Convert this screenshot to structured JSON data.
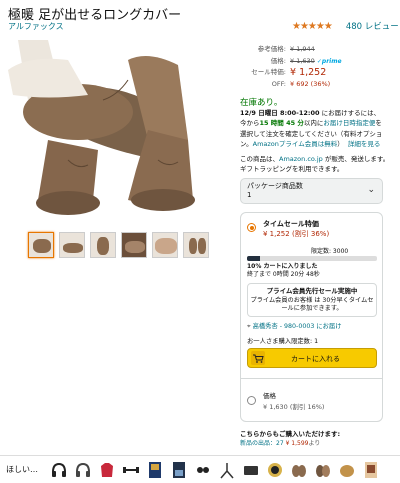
{
  "product": {
    "title": "極暖 足が出せるロングカバー",
    "brand": "アルファックス",
    "stars": "★★★★★",
    "rating_value": 4.5,
    "review_count": "480 レビュー"
  },
  "pricing": {
    "list_label": "参考価格:",
    "list_price": "¥ 1,944",
    "price_label": "価格:",
    "price": "¥ 1,630",
    "prime": "✓prime",
    "sale_label": "セール特価:",
    "sale_price": "¥ 1,252",
    "off_label": "OFF:",
    "off_value": "¥ 692 (36%)"
  },
  "availability": {
    "stock": "在庫あり。",
    "delivery_date": "12/9 日曜日 8:00-12:00",
    "delivery_text_1": " にお届けするには、今から",
    "countdown": "15 時間 45 分",
    "delivery_text_2": "以内に",
    "delivery_link_1": "お届け日時指定便",
    "delivery_text_3": "を選択して注文を確定してください（有料オプション。",
    "delivery_link_2": "Amazonプライム会員は無料",
    "delivery_text_4": "）",
    "details_link": "詳細を見る",
    "seller_text_1": "この商品は、",
    "seller_link": "Amazon.co.jp",
    "seller_text_2": " が販売、発送します。ギフトラッピングを利用できます。"
  },
  "package": {
    "label": "パッケージ商品数",
    "value": "1"
  },
  "deal": {
    "name": "タイムセール特価",
    "price": "¥ 1,252 (割引 36%)",
    "claimed_label": "限定数: 3000",
    "claimed_fraction": 0.1,
    "claimed_text": "10% カートに入りました",
    "ends_text": "終了まで 0時間 20分 48秒",
    "prime_head": "プライム会員先行セール実施中",
    "prime_body": "プライム会員のお客様 は 30分早くタイムセールに参加できます。",
    "address": "高橋秀杏 - 980-0003 にお届け",
    "limit_text": "お一人さま購入限定数: 1",
    "cart_button": "カートに入れる"
  },
  "alternative": {
    "name": "価格",
    "price": "¥ 1,630 (割引 16%)"
  },
  "other_sellers": {
    "heading": "こちらからもご購入いただけます:",
    "new_label": "新品の出品：",
    "new_count": "27",
    "new_price": "¥ 1,599",
    "new_suffix": "より"
  },
  "recommendation_strip": {
    "label": "ほしい…"
  },
  "colors": {
    "link": "#007185",
    "price_red": "#b12704",
    "stock_green": "#007600",
    "cart_yellow": "#f7ca00",
    "star_orange": "#de7921",
    "selected_orange": "#e77600"
  }
}
